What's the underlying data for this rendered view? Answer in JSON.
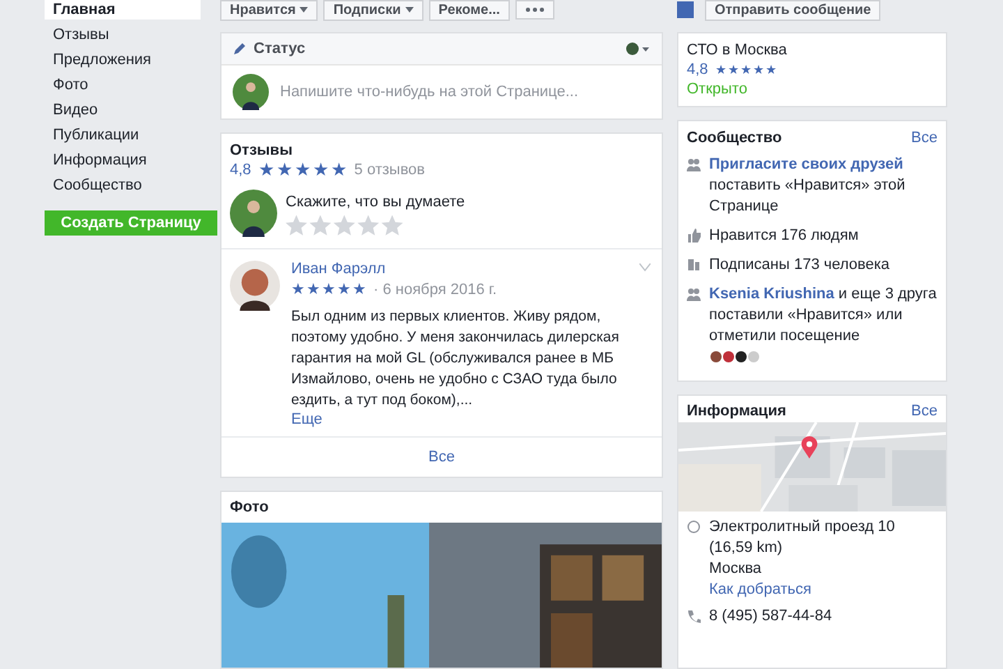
{
  "sidebar": {
    "items": [
      {
        "label": "Главная",
        "selected": true
      },
      {
        "label": "Отзывы",
        "selected": false
      },
      {
        "label": "Предложения",
        "selected": false
      },
      {
        "label": "Фото",
        "selected": false
      },
      {
        "label": "Видео",
        "selected": false
      },
      {
        "label": "Публикации",
        "selected": false
      },
      {
        "label": "Информация",
        "selected": false
      },
      {
        "label": "Сообщество",
        "selected": false
      }
    ],
    "create_button": "Создать Страницу"
  },
  "actions": [
    {
      "label": "Нравится",
      "dropdown": true
    },
    {
      "label": "Подписки",
      "dropdown": true
    },
    {
      "label": "Рекоме...",
      "dropdown": false
    }
  ],
  "message_button": "Отправить сообщение",
  "status": {
    "title": "Статус",
    "placeholder": "Напишите что-нибудь на этой Странице..."
  },
  "reviews": {
    "title": "Отзывы",
    "rating": "4,8",
    "stars": 5,
    "count": "5 отзывов",
    "prompt": "Скажите, что вы думаете",
    "items": [
      {
        "author": "Иван Фарэлл",
        "stars": 5,
        "date": "· 6 ноября 2016 г.",
        "text": "Был одним из первых клиентов. Живу рядом, поэтому удобно. У меня закончилась дилерская гарантия на мой GL (обслуживался ранее в МБ Измайлово, очень не удобно с СЗАО туда было ездить, а тут под боком),...",
        "more": "Еще"
      }
    ],
    "all": "Все"
  },
  "photos": {
    "title": "Фото"
  },
  "place": {
    "name": "СТО в Москва",
    "rating": "4,8",
    "stars": 5,
    "open": "Открыто"
  },
  "community": {
    "title": "Сообщество",
    "all": "Все",
    "items": [
      {
        "kind": "invite",
        "link": "Пригласите своих друзей",
        "text": "поставить «Нравится» этой Странице"
      },
      {
        "kind": "likes",
        "text": "Нравится 176 людям"
      },
      {
        "kind": "follows",
        "text": "Подписаны 173 человека"
      },
      {
        "kind": "friends",
        "link": "Ksenia Kriushina",
        "text": "и еще 3 друга поставили «Нравится» или отметили посещение"
      }
    ]
  },
  "info": {
    "title": "Информация",
    "all": "Все",
    "address": "Электролитный проезд 10 (16,59 km)",
    "city": "Москва",
    "directions": "Как добраться",
    "phone": "8 (495) 587-44-84"
  }
}
